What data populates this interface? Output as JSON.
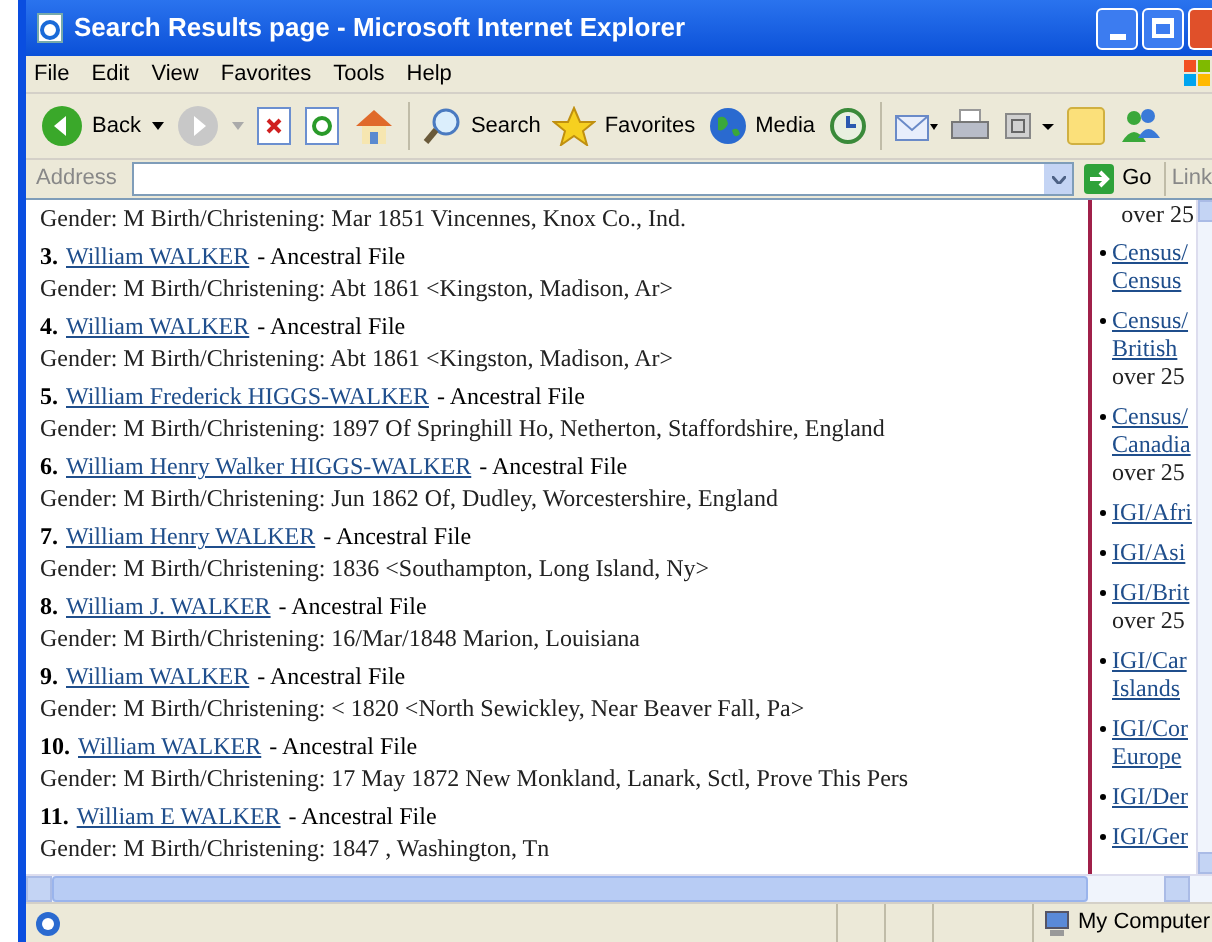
{
  "window": {
    "title": "Search Results page - Microsoft Internet Explorer"
  },
  "menu": [
    "File",
    "Edit",
    "View",
    "Favorites",
    "Tools",
    "Help"
  ],
  "toolbar": {
    "back": "Back",
    "search": "Search",
    "favorites": "Favorites",
    "media": "Media"
  },
  "address": {
    "label": "Address",
    "go": "Go",
    "links": "Link"
  },
  "results": [
    {
      "details": "Gender: M Birth/Christening: Mar 1851 Vincennes, Knox Co., Ind."
    },
    {
      "heading": {
        "number": "3.",
        "name": "William WALKER",
        "source": "- Ancestral File"
      },
      "details": "Gender: M Birth/Christening: Abt 1861 <Kingston, Madison, Ar>"
    },
    {
      "heading": {
        "number": "4.",
        "name": "William WALKER",
        "source": "- Ancestral File"
      },
      "details": "Gender: M Birth/Christening: Abt 1861 <Kingston, Madison, Ar>"
    },
    {
      "heading": {
        "number": "5.",
        "name": "William Frederick HIGGS-WALKER",
        "source": "- Ancestral File"
      },
      "details": "Gender: M Birth/Christening: 1897 Of Springhill Ho, Netherton, Staffordshire, England"
    },
    {
      "heading": {
        "number": "6.",
        "name": "William Henry Walker HIGGS-WALKER",
        "source": "- Ancestral File"
      },
      "details": "Gender: M Birth/Christening: Jun 1862 Of, Dudley, Worcestershire, England"
    },
    {
      "heading": {
        "number": "7.",
        "name": "William Henry WALKER",
        "source": "- Ancestral File"
      },
      "details": "Gender: M Birth/Christening: 1836 <Southampton, Long Island, Ny>"
    },
    {
      "heading": {
        "number": "8.",
        "name": "William J. WALKER",
        "source": "- Ancestral File"
      },
      "details": "Gender: M Birth/Christening: 16/Mar/1848 Marion, Louisiana"
    },
    {
      "heading": {
        "number": "9.",
        "name": "William WALKER",
        "source": "- Ancestral File"
      },
      "details": "Gender: M Birth/Christening: < 1820 <North Sewickley, Near Beaver Fall, Pa>"
    },
    {
      "heading": {
        "number": "10.",
        "name": "William WALKER",
        "source": "- Ancestral File"
      },
      "details": "Gender: M Birth/Christening: 17 May 1872 New Monkland, Lanark, Sctl, Prove This Pers"
    },
    {
      "heading": {
        "number": "11.",
        "name": "William E WALKER",
        "source": "- Ancestral File"
      },
      "details": "Gender: M Birth/Christening: 1847 , Washington, Tn"
    }
  ],
  "sidebar": {
    "top_note": "over 25",
    "items": [
      {
        "link": [
          "Census/",
          "Census"
        ]
      },
      {
        "link": [
          "Census/",
          "British"
        ],
        "note": "over 25"
      },
      {
        "link": [
          "Census/",
          "Canadia"
        ],
        "note": "over 25"
      },
      {
        "link": [
          "IGI/Afri"
        ]
      },
      {
        "link": [
          "IGI/Asi"
        ]
      },
      {
        "link": [
          "IGI/Brit"
        ],
        "note": "over 25"
      },
      {
        "link": [
          "IGI/Car",
          "Islands"
        ]
      },
      {
        "link": [
          "IGI/Cor",
          "Europe"
        ]
      },
      {
        "link": [
          "IGI/Der"
        ]
      },
      {
        "link": [
          "IGI/Ger"
        ]
      }
    ]
  },
  "status_bar": {
    "zone": "My Computer"
  }
}
